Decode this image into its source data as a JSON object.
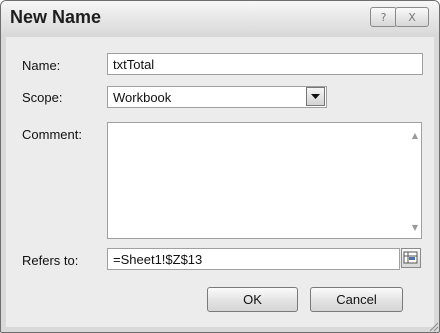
{
  "dialog": {
    "title": "New Name",
    "help_icon": "?",
    "close_icon": "X"
  },
  "form": {
    "name_label": "Name:",
    "name_value": "txtTotal",
    "scope_label": "Scope:",
    "scope_value": "Workbook",
    "comment_label": "Comment:",
    "comment_value": "",
    "refers_label": "Refers to:",
    "refers_value": "=Sheet1!$Z$13"
  },
  "buttons": {
    "ok_label": "OK",
    "cancel_label": "Cancel"
  },
  "icons": {
    "help": "help-icon",
    "close": "close-icon",
    "dropdown": "chevron-down-icon",
    "collapse": "collapse-dialog-icon",
    "resize": "resize-grip-icon"
  }
}
